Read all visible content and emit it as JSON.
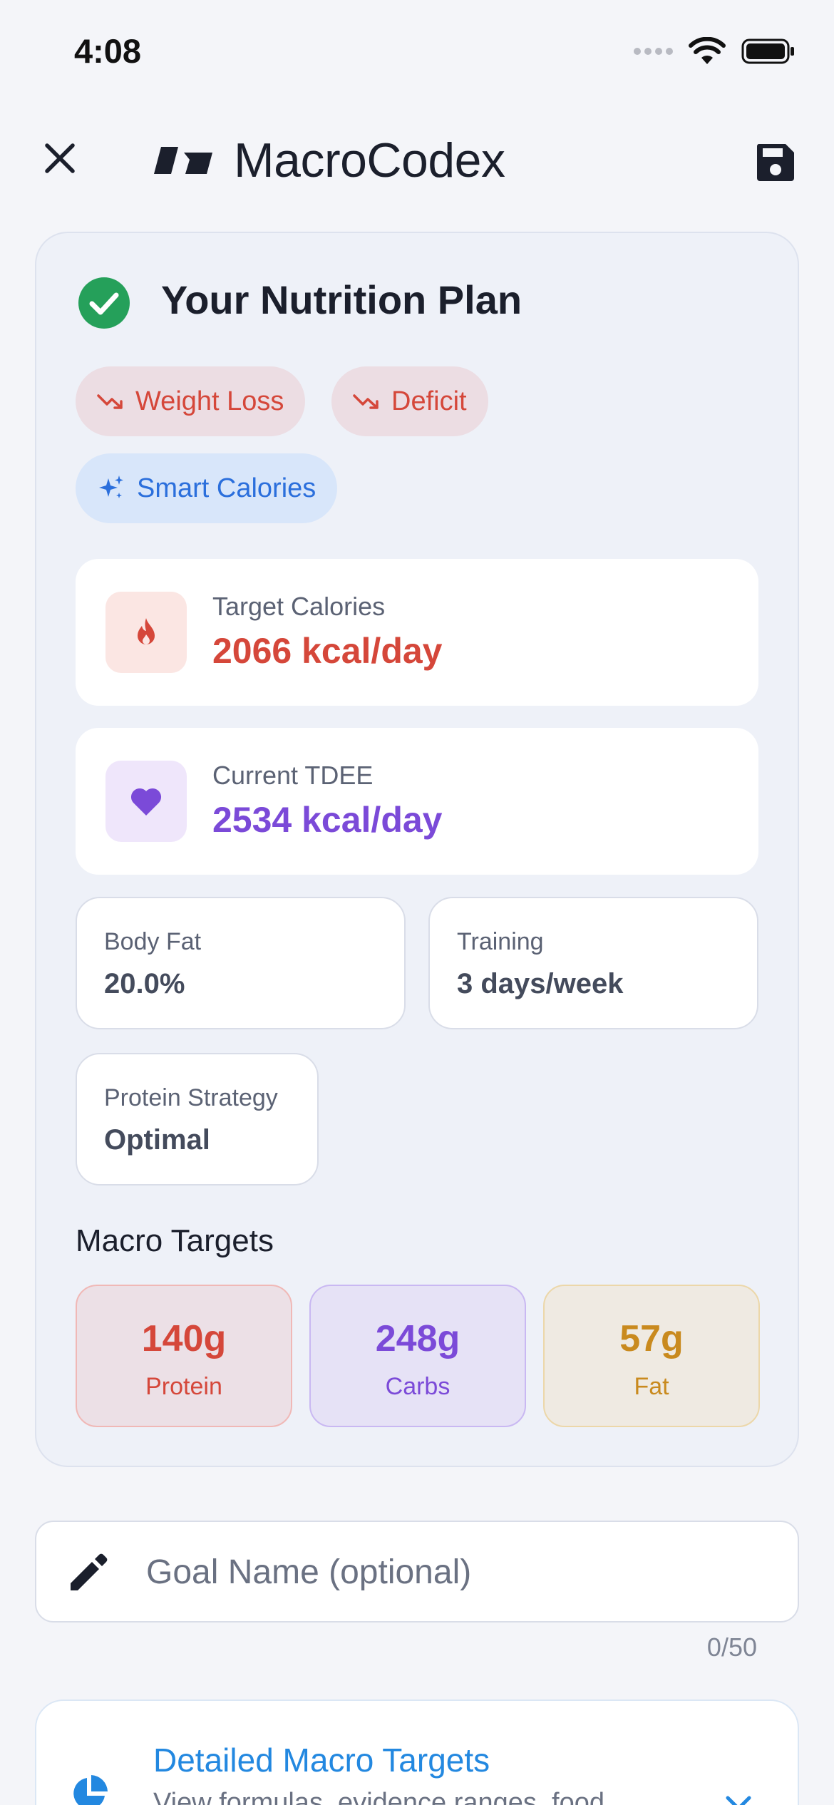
{
  "status": {
    "time": "4:08"
  },
  "header": {
    "title": "MacroCodex"
  },
  "plan": {
    "title": "Your Nutrition Plan",
    "chips": [
      {
        "label": "Weight Loss",
        "icon": "trending-down-icon"
      },
      {
        "label": "Deficit",
        "icon": "trending-down-icon"
      },
      {
        "label": "Smart Calories",
        "icon": "sparkles-icon"
      }
    ],
    "target": {
      "label": "Target Calories",
      "value": "2066 kcal/day",
      "icon": "flame-icon",
      "color": "#d5473a"
    },
    "tdee": {
      "label": "Current TDEE",
      "value": "2534 kcal/day",
      "icon": "heart-icon",
      "color": "#7b4ad8"
    },
    "body_fat": {
      "label": "Body Fat",
      "value": "20.0%"
    },
    "training": {
      "label": "Training",
      "value": "3 days/week"
    },
    "protein_strategy": {
      "label": "Protein Strategy",
      "value": "Optimal"
    },
    "macros": {
      "title": "Macro Targets",
      "items": [
        {
          "value": "140g",
          "label": "Protein",
          "color": "#d5473a"
        },
        {
          "value": "248g",
          "label": "Carbs",
          "color": "#7b4ad8"
        },
        {
          "value": "57g",
          "label": "Fat",
          "color": "#c98a1e"
        }
      ]
    }
  },
  "goal": {
    "placeholder": "Goal Name (optional)",
    "value": "",
    "count": "0/50"
  },
  "detailed": {
    "title": "Detailed Macro Targets",
    "subtitle": "View formulas, evidence ranges, food"
  }
}
